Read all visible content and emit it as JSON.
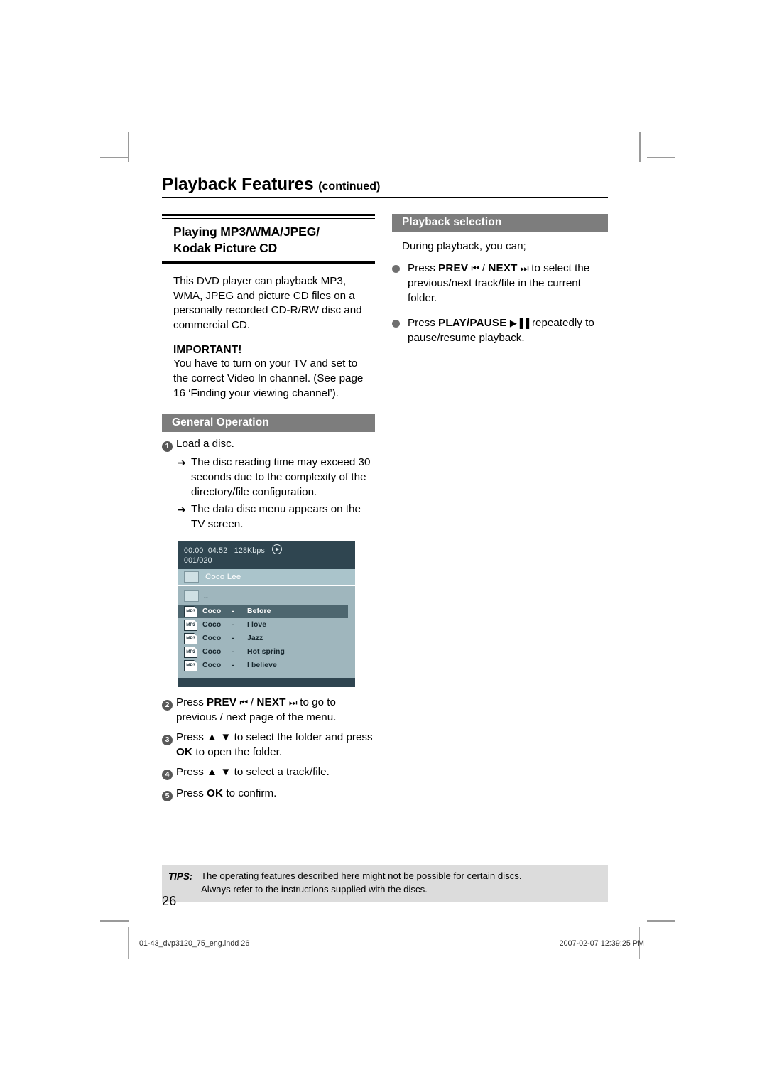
{
  "running_head": {
    "title": "Playback Features",
    "continued": "(continued)"
  },
  "left_column": {
    "section_title_line1": "Playing MP3/WMA/JPEG/",
    "section_title_line2": "Kodak Picture CD",
    "intro_paragraph": "This DVD player can playback MP3, WMA, JPEG and picture CD files on a personally recorded CD-R/RW disc and commercial CD.",
    "important_label": "IMPORTANT!",
    "important_paragraph": "You have to turn on your TV and set to the correct Video In channel.  (See page 16 ‘Finding your viewing channel’).",
    "general_operation_heading": "General Operation",
    "steps": [
      {
        "number": "1",
        "text": "Load a disc.",
        "sub_items": [
          "The disc reading time may exceed 30 seconds due to the complexity of the directory/file configuration.",
          "The data disc menu appears on the TV screen."
        ]
      },
      {
        "number": "2",
        "prefix": "Press ",
        "key1": "PREV",
        "glyph1": "⏮",
        "sep": " / ",
        "key2": "NEXT",
        "glyph2": "⏭",
        "suffix": " to go to previous / next page of the menu."
      },
      {
        "number": "3",
        "prefix": "Press ",
        "glyph_up": "▲",
        "glyph_down": "▼",
        "mid": " to select the folder and press ",
        "key": "OK",
        "suffix": " to open the folder."
      },
      {
        "number": "4",
        "prefix": "Press ",
        "glyph_up": "▲",
        "glyph_down": "▼",
        "suffix": " to select a track/file."
      },
      {
        "number": "5",
        "prefix": "Press ",
        "key": "OK",
        "suffix": " to confirm."
      }
    ]
  },
  "tv_screen": {
    "status": {
      "elapsed_time": "00:00",
      "total_time": "04:52",
      "bitrate": "128Kbps",
      "play_icon": "play-icon",
      "track_counter": "001/020"
    },
    "current_folder": "Coco Lee",
    "parent_dir_label": "..",
    "tracks": [
      {
        "icon": "MP3",
        "artist": "Coco",
        "dash": "-",
        "title": "Before",
        "selected": true
      },
      {
        "icon": "MP3",
        "artist": "Coco",
        "dash": "-",
        "title": "I love",
        "selected": false
      },
      {
        "icon": "MP3",
        "artist": "Coco",
        "dash": "-",
        "title": "Jazz",
        "selected": false
      },
      {
        "icon": "MP3",
        "artist": "Coco",
        "dash": "-",
        "title": "Hot spring",
        "selected": false
      },
      {
        "icon": "MP3",
        "artist": "Coco",
        "dash": "-",
        "title": "I believe",
        "selected": false
      }
    ],
    "colors": {
      "status_bar": "#2f4550",
      "folder_bar": "#aac4cb",
      "list_background": "#9fb6bd",
      "selected_row": "#4d666f"
    }
  },
  "right_column": {
    "heading": "Playback selection",
    "intro": "During playback, you can;",
    "bullets": [
      {
        "prefix": "Press ",
        "key1": "PREV",
        "glyph1": "⏮",
        "sep": " / ",
        "key2": "NEXT",
        "glyph2": "⏭",
        "suffix": " to select the previous/next track/file in the current folder."
      },
      {
        "prefix": "Press ",
        "key1": "PLAY/PAUSE",
        "glyph1": "▶▐▐",
        "suffix": " repeatedly to pause/resume playback."
      }
    ]
  },
  "tips": {
    "label": "TIPS:",
    "line1": "The operating features described here might not be possible for certain discs.",
    "line2": "Always refer to the instructions supplied with the discs."
  },
  "page_number": "26",
  "footer": {
    "file_slug": "01-43_dvp3120_75_eng.indd   26",
    "timestamp": "2007-02-07   12:39:25 PM"
  }
}
